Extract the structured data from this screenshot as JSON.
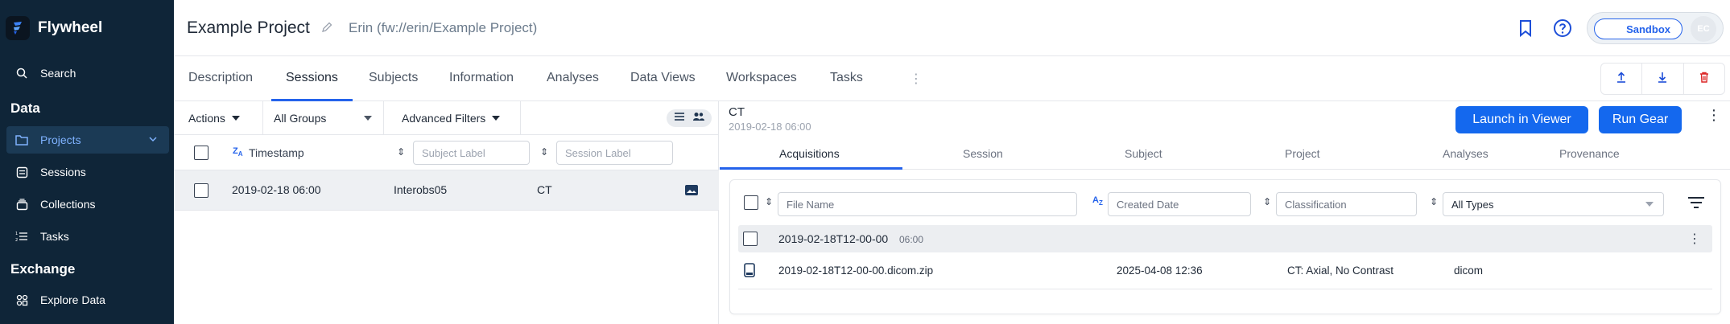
{
  "sidebar": {
    "brand": "Flywheel",
    "search": "Search",
    "section_data": "Data",
    "items": [
      {
        "label": "Projects",
        "icon": "folder-icon"
      },
      {
        "label": "Sessions",
        "icon": "sessions-icon"
      },
      {
        "label": "Collections",
        "icon": "collections-icon"
      },
      {
        "label": "Tasks",
        "icon": "tasks-icon"
      }
    ],
    "section_exchange": "Exchange",
    "explore": "Explore Data"
  },
  "header": {
    "title": "Example Project",
    "path": "Erin (fw://erin/Example Project)",
    "sandbox_label": "Sandbox",
    "avatar_initials": "EC"
  },
  "tabs": [
    "Description",
    "Sessions",
    "Subjects",
    "Information",
    "Analyses",
    "Data Views",
    "Workspaces",
    "Tasks"
  ],
  "tabs_more": "⋮",
  "sessions_panel": {
    "actions_label": "Actions",
    "groups_label": "All Groups",
    "filters_label": "Advanced Filters",
    "col_timestamp": "Timestamp",
    "subject_placeholder": "Subject Label",
    "session_placeholder": "Session Label",
    "row": {
      "timestamp": "2019-02-18 06:00",
      "subject": "Interobs05",
      "session": "CT"
    }
  },
  "detail_panel": {
    "title": "CT",
    "subtitle": "2019-02-18 06:00",
    "launch_label": "Launch in Viewer",
    "run_gear_label": "Run Gear",
    "subtabs": [
      "Acquisitions",
      "Session",
      "Subject",
      "Project",
      "Analyses",
      "Provenance"
    ],
    "file_name_placeholder": "File Name",
    "created_date_placeholder": "Created Date",
    "classification_placeholder": "Classification",
    "types_value": "All Types",
    "group": {
      "label": "2019-02-18T12-00-00",
      "time": "06:00"
    },
    "file": {
      "name": "2019-02-18T12-00-00.dicom.zip",
      "created": "2025-04-08 12:36",
      "classification": "CT: Axial, No Contrast",
      "type": "dicom"
    }
  },
  "colors": {
    "sidebar_bg": "#0f2538",
    "accent": "#1468ee",
    "delete": "#dc2626"
  }
}
